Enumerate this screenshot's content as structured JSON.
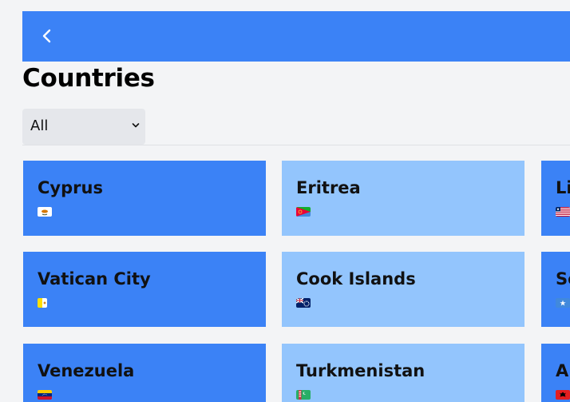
{
  "page": {
    "title": "Countries"
  },
  "header": {
    "back_icon": "chevron-left-icon"
  },
  "filter": {
    "selected": "All"
  },
  "countries": [
    {
      "name": "Cyprus",
      "flag_icon": "cyprus-flag-icon",
      "style": "dark"
    },
    {
      "name": "Eritrea",
      "flag_icon": "eritrea-flag-icon",
      "style": "light"
    },
    {
      "name": "Liberia",
      "flag_icon": "liberia-flag-icon",
      "style": "dark"
    },
    {
      "name": "Vatican City",
      "flag_icon": "vatican-flag-icon",
      "style": "dark"
    },
    {
      "name": "Cook Islands",
      "flag_icon": "cook-islands-flag-icon",
      "style": "light"
    },
    {
      "name": "Somalia",
      "flag_icon": "somalia-flag-icon",
      "style": "dark"
    },
    {
      "name": "Venezuela",
      "flag_icon": "venezuela-flag-icon",
      "style": "dark"
    },
    {
      "name": "Turkmenistan",
      "flag_icon": "turkmenistan-flag-icon",
      "style": "light"
    },
    {
      "name": "Albania",
      "flag_icon": "albania-flag-icon",
      "style": "dark"
    }
  ],
  "colors": {
    "header": "#3b82f6",
    "card_dark": "#3b82f6",
    "card_light": "#93c5fd",
    "background": "#f3f4f6"
  }
}
